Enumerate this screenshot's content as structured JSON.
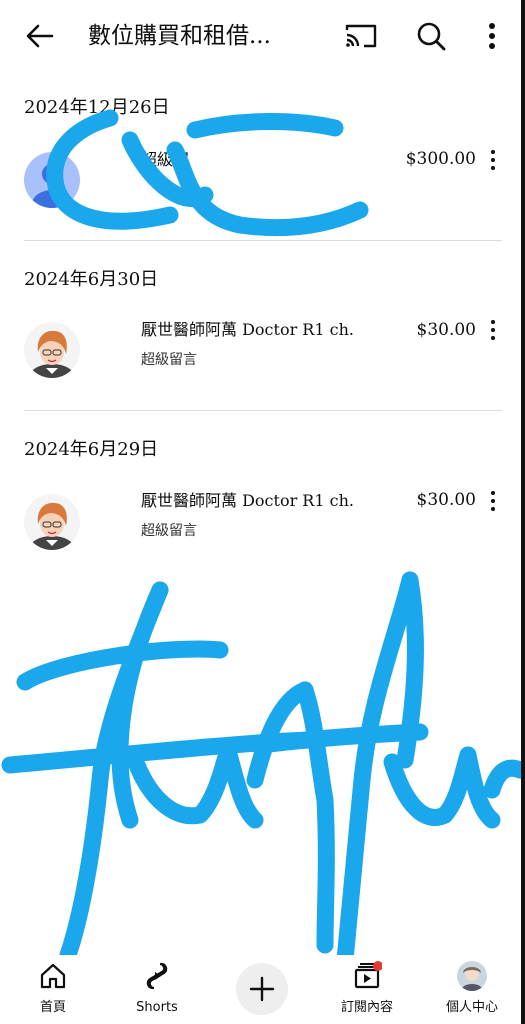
{
  "header": {
    "title": "數位購買和租借...",
    "icons": [
      "back-arrow-icon",
      "cast-icon",
      "search-icon",
      "more-vertical-icon"
    ]
  },
  "entries": [
    {
      "date": "2024年12月26日",
      "name": "超級留",
      "type": "",
      "price": "$300.00",
      "avatar": "default-avatar-icon"
    },
    {
      "date": "2024年6月30日",
      "name": "厭世醫師阿萬 Doctor R1 ch.",
      "type": "超級留言",
      "price": "$30.00",
      "avatar": "channel-avatar"
    },
    {
      "date": "2024年6月29日",
      "name": "厭世醫師阿萬 Doctor R1 ch.",
      "type": "超級留言",
      "price": "$30.00",
      "avatar": "channel-avatar"
    }
  ],
  "nav": {
    "home": "首頁",
    "shorts": "Shorts",
    "create": "+",
    "subscriptions": "訂閱內容",
    "profile": "個人中心"
  },
  "colors": {
    "scribble": "#1aa7ec",
    "notification_dot": "#e53935"
  }
}
